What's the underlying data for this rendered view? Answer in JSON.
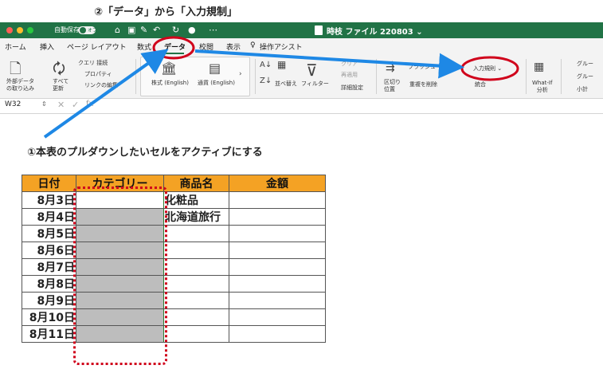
{
  "step2_caption": "②「データ」から「入力規制」",
  "step1_caption": "①本表のプルダウンしたいセルをアクティブにする",
  "titlebar": {
    "autosave": "自動保存",
    "toggle": "オフ",
    "title": "時枝 ファイル 220803 ⌄"
  },
  "tabs": [
    "ホーム",
    "挿入",
    "ページ レイアウト",
    "数式",
    "データ",
    "校閲",
    "表示",
    "操作アシスト"
  ],
  "ribbon": {
    "get_external": "外部データ\nの取り込み",
    "refresh_all": "すべて\n更新",
    "queries": "クエリ  接続",
    "properties": "プロパティ",
    "edit_links": "リンクの編集",
    "stocks": "株式 (English)",
    "currency": "通貨 (English)",
    "sort": "並べ替え",
    "filter": "フィルター",
    "clear": "クリア",
    "reapply": "再適用",
    "advanced": "詳細設定",
    "text_to_columns": "区切り\n位置",
    "flash_fill": "フラッシュ フィル",
    "remove_dups": "重複を削除",
    "data_validation": "入力規則 ⌄",
    "consolidate": "統合",
    "what_if": "What-If\n分析",
    "group": "グルー",
    "ungroup": "グルー",
    "subtotal": "小計"
  },
  "formula_bar": {
    "cell_ref": "W32",
    "fx": "fx"
  },
  "sheet": {
    "headers": [
      "日付",
      "カテゴリー",
      "商品名",
      "金額"
    ],
    "rows": [
      [
        "8月3日",
        "",
        "化粧品",
        ""
      ],
      [
        "8月4日",
        "",
        "北海道旅行",
        ""
      ],
      [
        "8月5日",
        "",
        "",
        ""
      ],
      [
        "8月6日",
        "",
        "",
        ""
      ],
      [
        "8月7日",
        "",
        "",
        ""
      ],
      [
        "8月8日",
        "",
        "",
        ""
      ],
      [
        "8月9日",
        "",
        "",
        ""
      ],
      [
        "8月10日",
        "",
        "",
        ""
      ],
      [
        "8月11日",
        "",
        "",
        ""
      ]
    ]
  },
  "colors": {
    "excel_green": "#217346",
    "header_orange": "#f4a224",
    "annotation_red": "#d0021b",
    "arrow_blue": "#1e88e5",
    "selected_gray": "#bdbdbd"
  }
}
